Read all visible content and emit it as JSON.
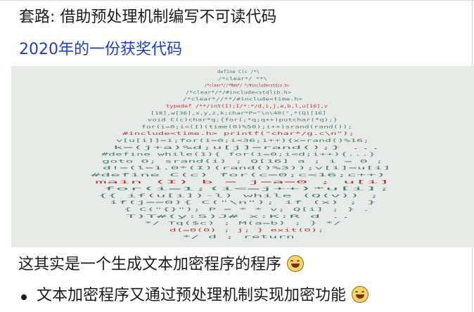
{
  "slide": {
    "title": "套路: 借助预处理机制编写不可读代码",
    "subtitle": "2020年的一份获奖代码",
    "body": "这其实是一个生成文本加密程序的程序",
    "bullets": [
      "文本加密程序又通过预处理机制实现加密功能"
    ]
  },
  "code_art": {
    "description_color": "#4a7a6b",
    "accent_color": "#b0383b",
    "lines": [
      "define C(c          /*\\",
      "/*clear*/           **\\",
      "/*clear*//*Mem*/ */#include<stdio.h>",
      "/*clear*/*/#include<stdlib.h>",
      "/*clear*//**/#include<time.h>",
      "typedef /**/int(I);I/*:*/d,i,j,a,b,l,u[16],v",
      "[18],w[36],x,y,z,k;char*P=\"\\n\\40(\",*(Q)[16]",
      "void C(c)char*q;{for(;*q;q++)putchar(*q);}",
      "for(i=0;i<(I)(time(0)%50);i++)srand(rand());",
      "#include<time.h>  printf(\"char*/g.c\\n\");",
      "v[u[i]]=i;for(i=0;i<36;i++){x=rand()%16;",
      "k=(j+a)%d;u[j]=rand();} ...",
      "#define  while(1){ for(i=0;i<d;i++){...}",
      "goto  O;  srand(i) ; Q[16] a ; i = 0 ;",
      "d!=(l=1.0*(I)(rand()%3));v[i]=u[i]",
      "#define C(c) for(c=0;c<16;c++)",
      "main  (I) b = j=a=0  ;  u[i]",
      "for(i=1;(i<=j++)*u[i];",
      "{{ if(u[i])-l) while (Q(v)) ;",
      "if(j==0){ C(\"\\n\"); if (x) ; }",
      "{ C(\"{}\"); P = * * v; Q[i] ; } .",
      "T)T#(y:5)J# x:K:R d ..",
      "*/ Tq($c) ; M(a=b) ; } */",
      "d(=0(0) ; j;  } exit(0);",
      "*/ d ; return"
    ]
  }
}
